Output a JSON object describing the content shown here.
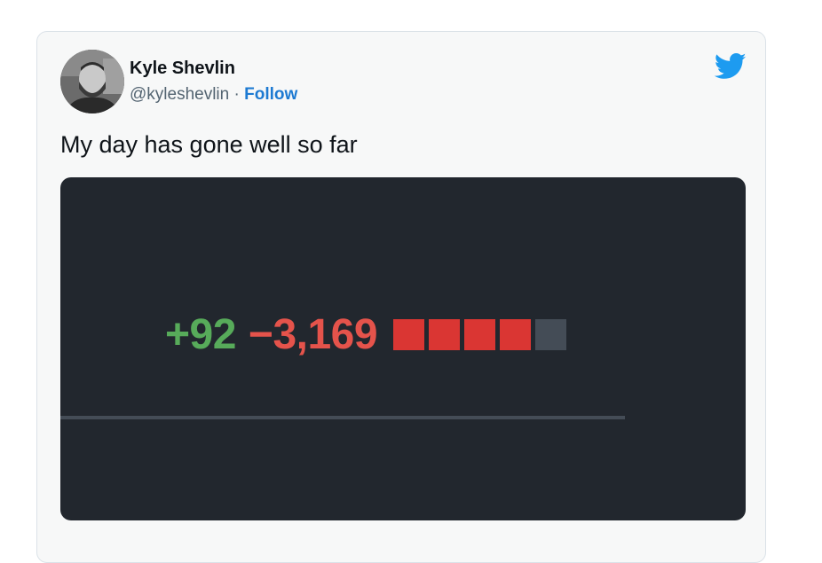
{
  "tweet": {
    "author_name": "Kyle Shevlin",
    "handle": "@kyleshevlin",
    "separator": " · ",
    "follow_label": "Follow",
    "text": "My day has gone well so far"
  },
  "media": {
    "additions": "+92",
    "deletions": "−3,169",
    "diffstat": [
      "deletion",
      "deletion",
      "deletion",
      "deletion",
      "neutral"
    ]
  },
  "icons": {
    "logo": "twitter-bird-icon",
    "avatar": "avatar-photo"
  },
  "colors": {
    "follow": "#1d7ad2",
    "twitter_blue": "#1d9bf0",
    "additions": "#57ab5a",
    "deletions": "#e5534b",
    "media_bg": "#22272e"
  }
}
